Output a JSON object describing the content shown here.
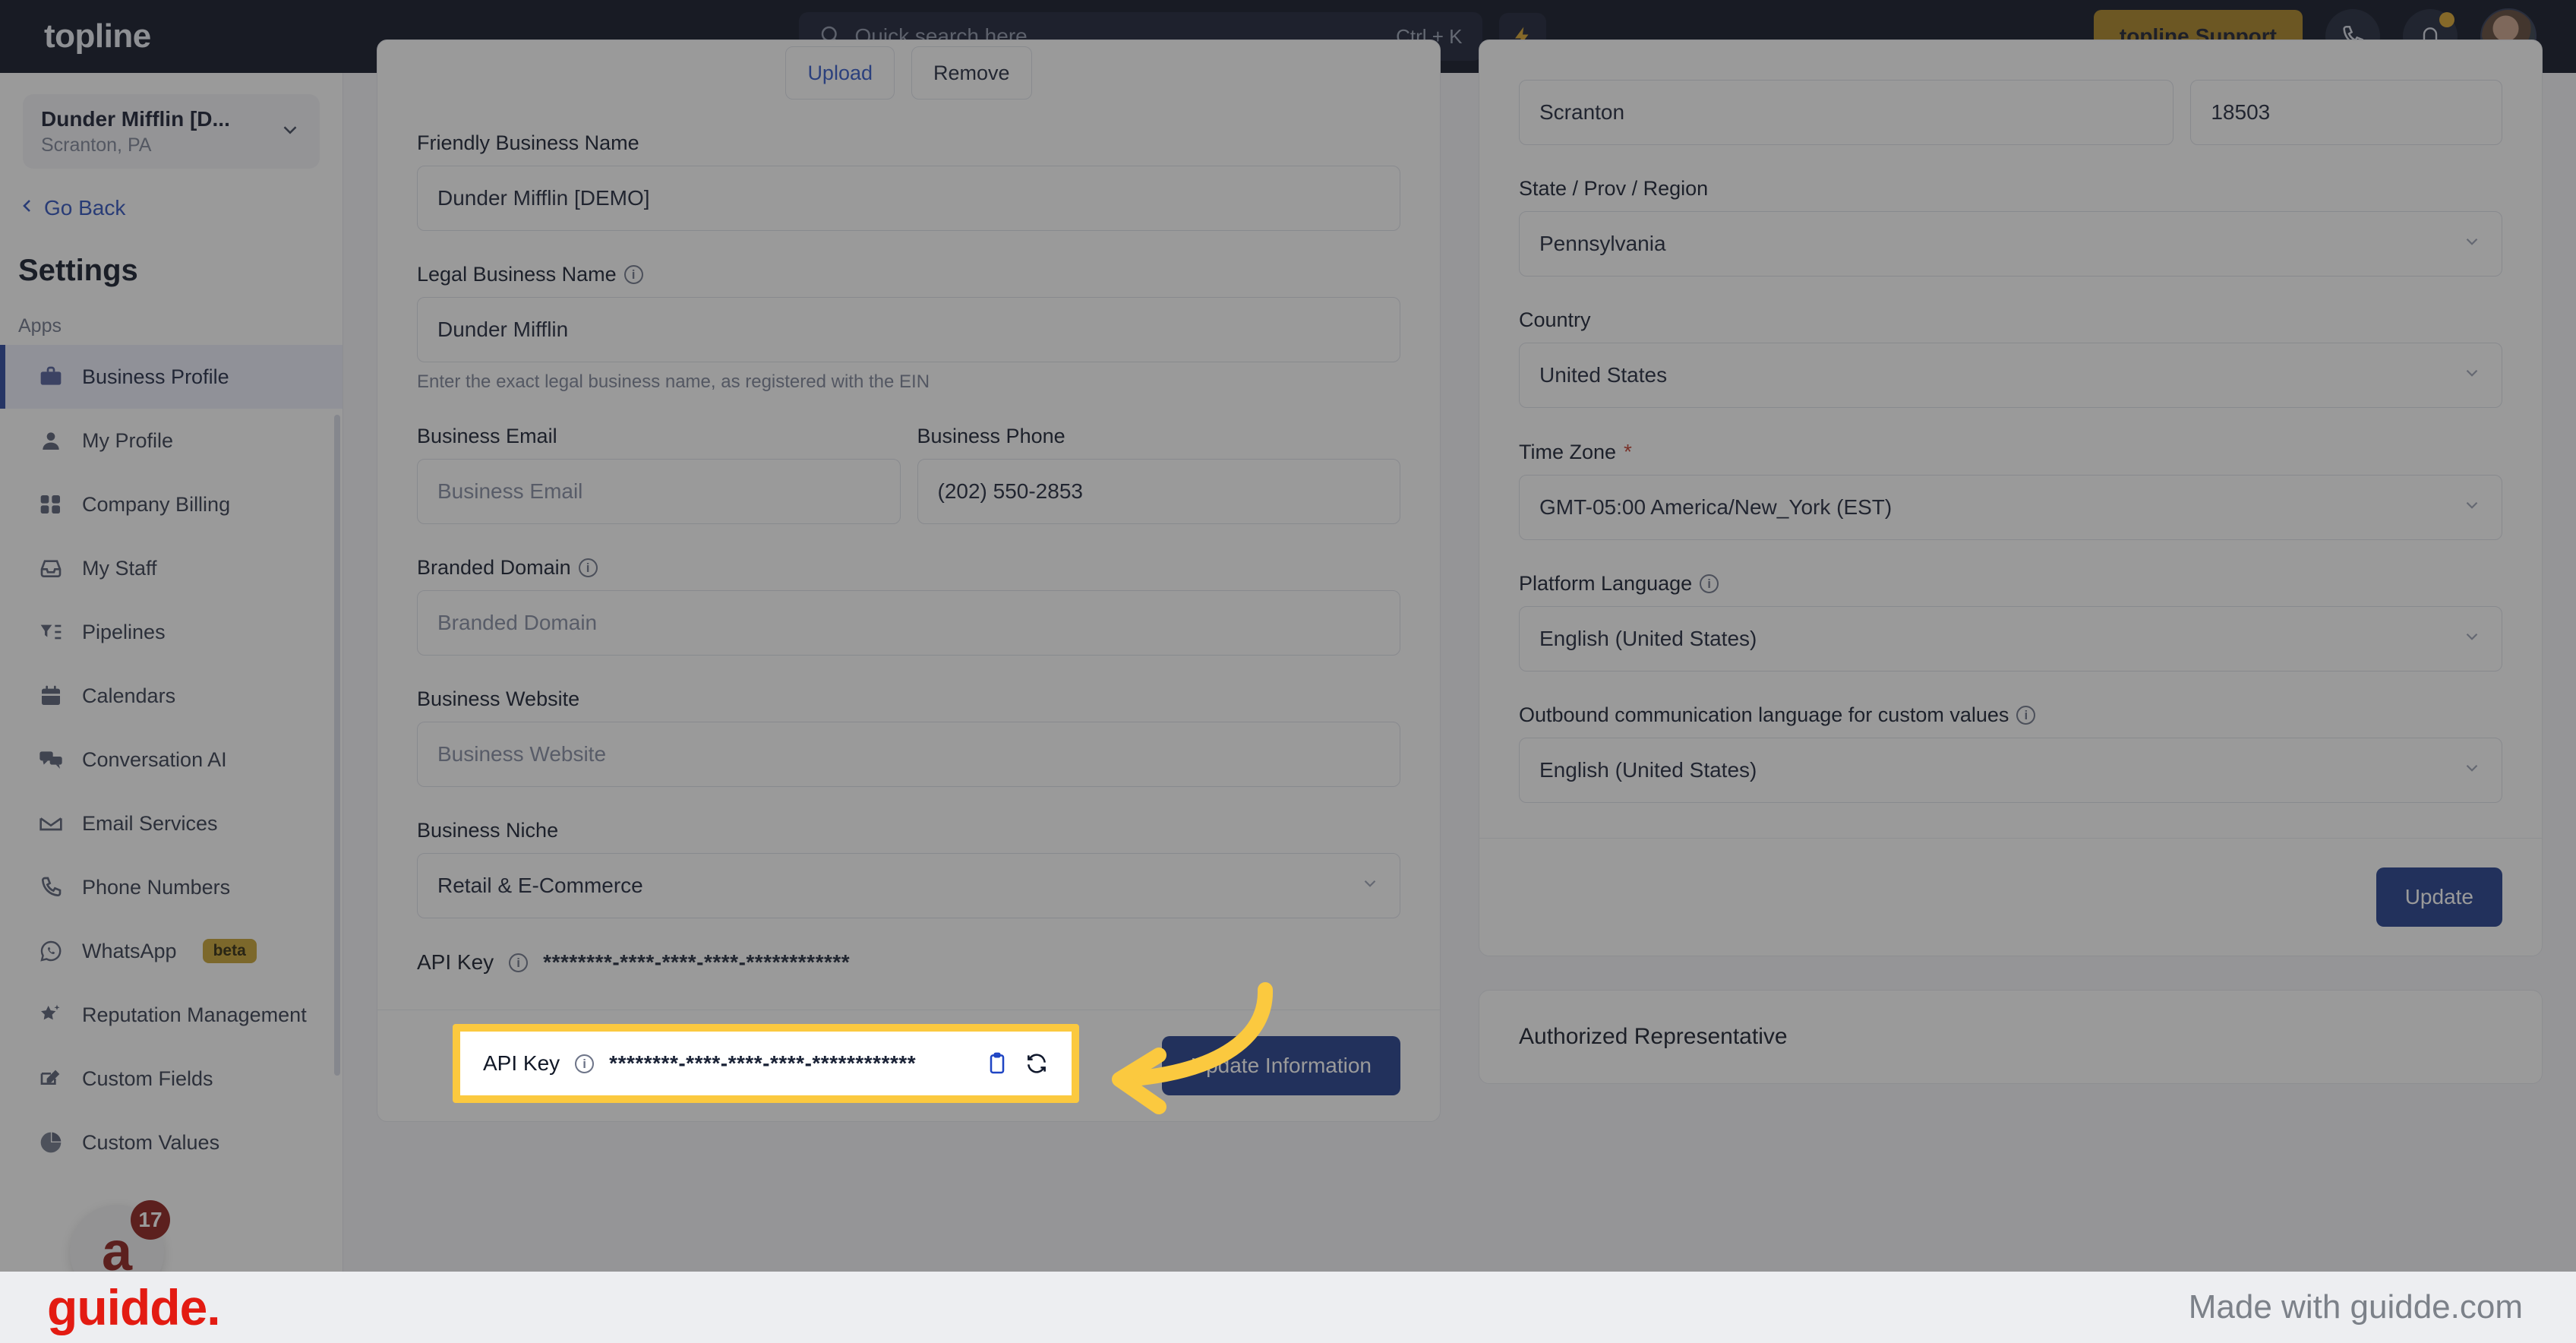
{
  "topbar": {
    "brand": "topline",
    "search_placeholder": "Quick search here",
    "search_shortcut": "Ctrl + K",
    "bolt_icon": "lightning-bolt-icon",
    "support_brand": "topline",
    "support_label": "Support",
    "phone_icon": "phone-icon",
    "bell_icon": "bell-icon",
    "avatar_alt": "user-avatar"
  },
  "sidebar": {
    "location_name": "Dunder Mifflin [D...",
    "location_sub": "Scranton, PA",
    "go_back": "Go Back",
    "settings_title": "Settings",
    "group_label": "Apps",
    "items": [
      {
        "label": "Business Profile",
        "icon": "briefcase-icon",
        "active": true,
        "badge": ""
      },
      {
        "label": "My Profile",
        "icon": "person-icon",
        "active": false,
        "badge": ""
      },
      {
        "label": "Company Billing",
        "icon": "calculator-icon",
        "active": false,
        "badge": ""
      },
      {
        "label": "My Staff",
        "icon": "inbox-icon",
        "active": false,
        "badge": ""
      },
      {
        "label": "Pipelines",
        "icon": "filter-list-icon",
        "active": false,
        "badge": ""
      },
      {
        "label": "Calendars",
        "icon": "calendar-icon",
        "active": false,
        "badge": ""
      },
      {
        "label": "Conversation AI",
        "icon": "chat-bubbles-icon",
        "active": false,
        "badge": ""
      },
      {
        "label": "Email Services",
        "icon": "envelope-icon",
        "active": false,
        "badge": ""
      },
      {
        "label": "Phone Numbers",
        "icon": "phone-icon",
        "active": false,
        "badge": ""
      },
      {
        "label": "WhatsApp",
        "icon": "whatsapp-icon",
        "active": false,
        "badge": "beta"
      },
      {
        "label": "Reputation Management",
        "icon": "star-sparkle-icon",
        "active": false,
        "badge": ""
      },
      {
        "label": "Custom Fields",
        "icon": "edit-box-icon",
        "active": false,
        "badge": ""
      },
      {
        "label": "Custom Values",
        "icon": "pie-chart-icon",
        "active": false,
        "badge": ""
      }
    ],
    "chat_widget_letter": "a",
    "chat_widget_count": "17"
  },
  "left_card": {
    "upload_label": "Upload",
    "remove_label": "Remove",
    "fields": [
      {
        "label": "Friendly Business Name",
        "value": "Dunder Mifflin [DEMO]",
        "placeholder": "",
        "info": false,
        "hint": ""
      },
      {
        "label": "Legal Business Name",
        "value": "Dunder Mifflin",
        "placeholder": "",
        "info": true,
        "hint": "Enter the exact legal business name, as registered with the EIN"
      },
      {
        "label": "Business Email",
        "value": "",
        "placeholder": "Business Email",
        "info": false,
        "hint": ""
      },
      {
        "label": "Business Phone",
        "value": "(202) 550-2853",
        "placeholder": "",
        "info": false,
        "hint": ""
      },
      {
        "label": "Branded Domain",
        "value": "",
        "placeholder": "Branded Domain",
        "info": true,
        "hint": ""
      },
      {
        "label": "Business Website",
        "value": "",
        "placeholder": "Business Website",
        "info": false,
        "hint": ""
      },
      {
        "label": "Business Niche",
        "value": "Retail & E-Commerce",
        "placeholder": "",
        "info": false,
        "hint": ""
      }
    ],
    "api_key": {
      "label": "API Key",
      "info_icon": "info-icon",
      "masked_value": "********-****-****-****-************",
      "copy_icon": "clipboard-copy-icon",
      "refresh_icon": "refresh-icon"
    },
    "update_button": "Update Information"
  },
  "right_card": {
    "city_value": "Scranton",
    "postal_value": "18503",
    "fields": [
      {
        "label": "State / Prov / Region",
        "value": "Pennsylvania",
        "info": false,
        "required": false
      },
      {
        "label": "Country",
        "value": "United States",
        "info": false,
        "required": false
      },
      {
        "label": "Time Zone",
        "value": "GMT-05:00 America/New_York (EST)",
        "info": false,
        "required": true
      },
      {
        "label": "Platform Language",
        "value": "English (United States)",
        "info": true,
        "required": false
      },
      {
        "label": "Outbound communication language for custom values",
        "value": "English (United States)",
        "info": true,
        "required": false
      }
    ],
    "update_button": "Update",
    "authorized_rep_title": "Authorized Representative"
  },
  "footer": {
    "logo": "guidde.",
    "made_with": "Made with guidde.com"
  },
  "colors": {
    "topbar_bg": "#0b1020",
    "accent_gold": "#a9801f",
    "primary_blue": "#1e3a8a",
    "link_blue": "#2f55c8",
    "highlight_yellow": "#fbc93f",
    "guidde_red": "#e31b12"
  }
}
